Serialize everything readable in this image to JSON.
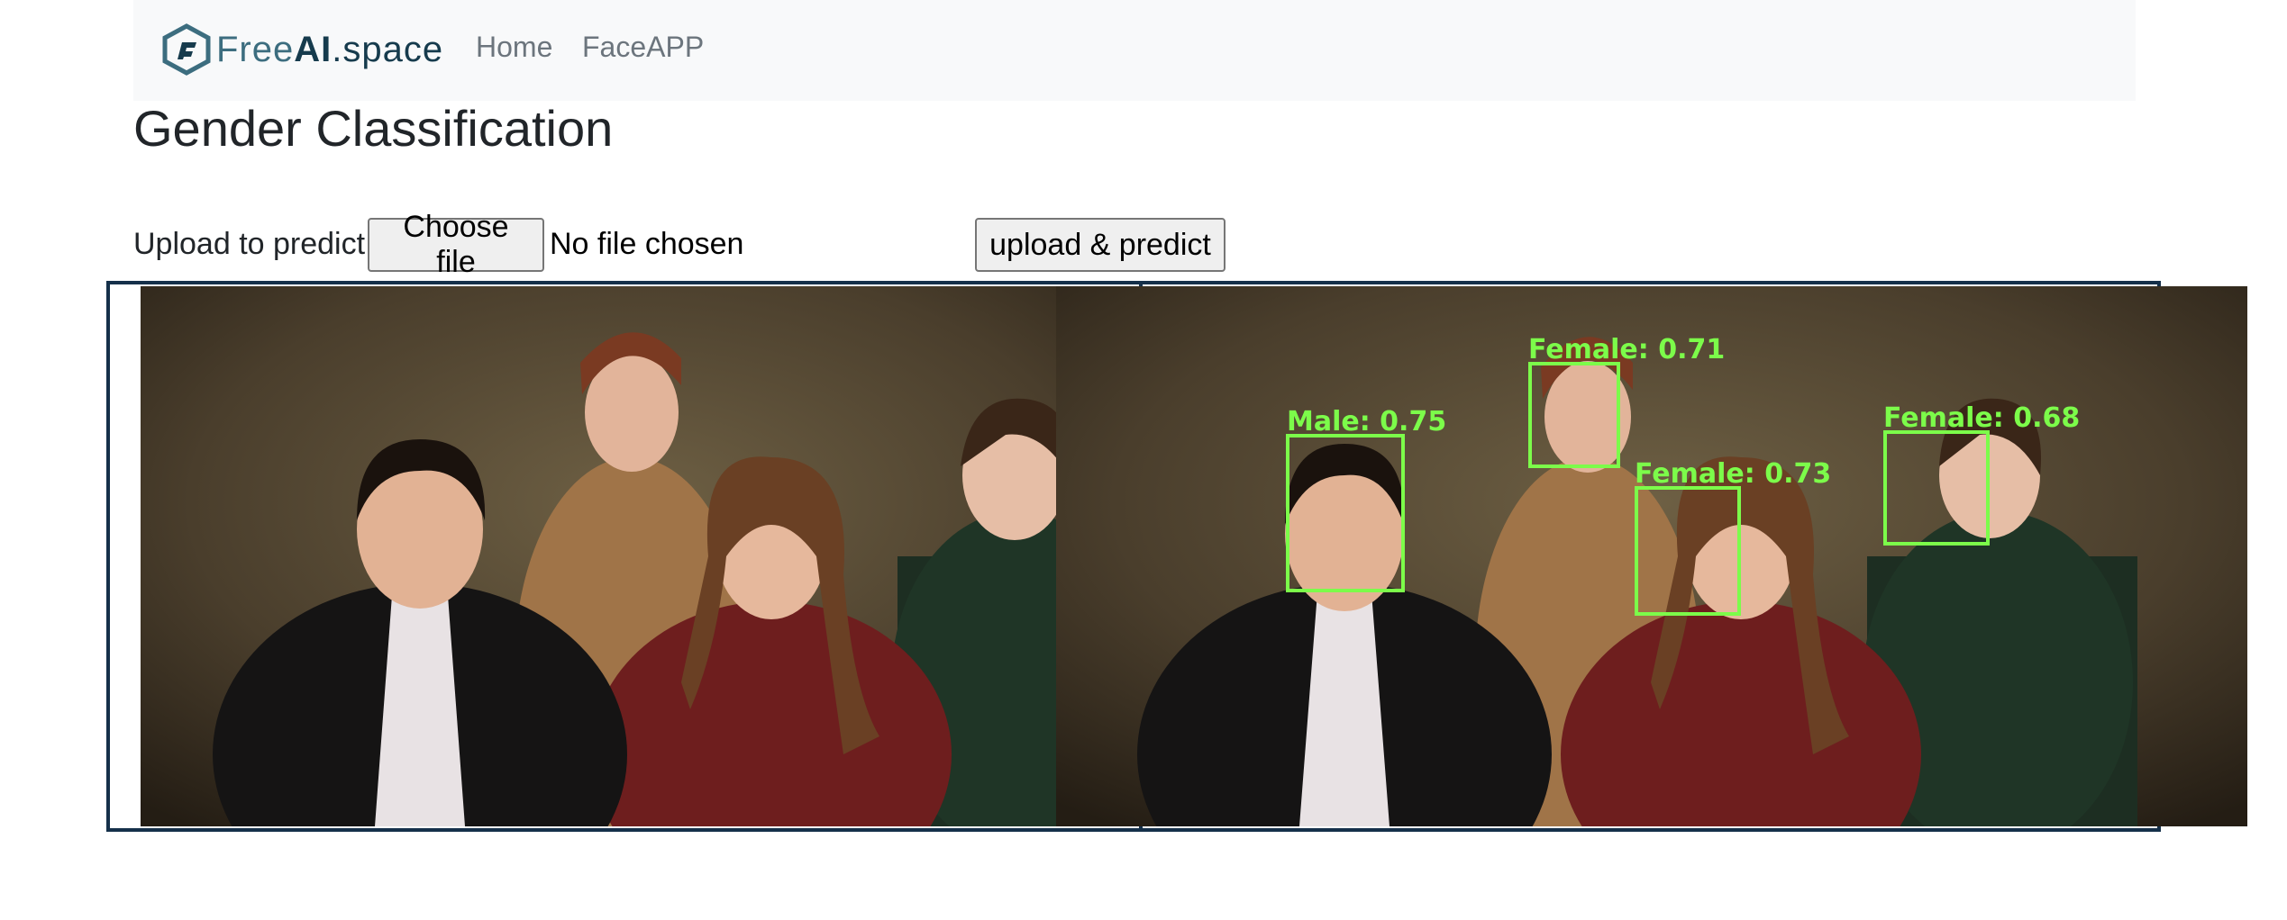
{
  "navbar": {
    "brand": {
      "free": "Free",
      "ai": "AI",
      "space": ".space"
    },
    "links": [
      "Home",
      "FaceAPP"
    ]
  },
  "page": {
    "title": "Gender Classification"
  },
  "upload": {
    "label": "Upload to predict",
    "choose_button": "Choose file",
    "file_status": "No file chosen",
    "submit_button": "upload & predict"
  },
  "detections": [
    {
      "label": "Male",
      "score": "0.75",
      "text": "Male: 0.75"
    },
    {
      "label": "Female",
      "score": "0.71",
      "text": "Female: 0.71"
    },
    {
      "label": "Female",
      "score": "0.73",
      "text": "Female: 0.73"
    },
    {
      "label": "Female",
      "score": "0.68",
      "text": "Female: 0.68"
    }
  ],
  "colors": {
    "frame_border": "#15304a",
    "detection_box": "#7CFC4A",
    "navbar_bg": "#f8f9fa",
    "brand_primary": "#3c6d7f",
    "brand_dark": "#163b4d"
  }
}
